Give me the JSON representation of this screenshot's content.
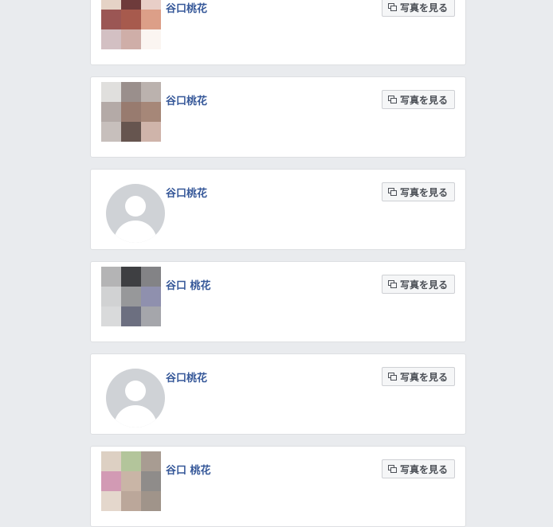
{
  "results": [
    {
      "name": "谷口桃花",
      "button_label": "写真を見る",
      "avatar_type": "photo",
      "avatar_colors": [
        "#e5d3c6",
        "#6e3b3b",
        "#e8cec7",
        "#9b5654",
        "#a75a4d",
        "#dc9f88",
        "#d3c0c3",
        "#cfaea8",
        "#fbf5f1"
      ]
    },
    {
      "name": "谷口桃花",
      "button_label": "写真を見る",
      "avatar_type": "photo",
      "avatar_colors": [
        "#e0dfdd",
        "#9a8f8c",
        "#bbb2ae",
        "#b4aaa7",
        "#987b6f",
        "#a68778",
        "#c7bfbc",
        "#66554f",
        "#cfb4aa"
      ]
    },
    {
      "name": "谷口桃花",
      "button_label": "写真を見る",
      "avatar_type": "default"
    },
    {
      "name": "谷口 桃花",
      "button_label": "写真を見る",
      "avatar_type": "photo",
      "avatar_colors": [
        "#b4b4b5",
        "#3e3f42",
        "#838386",
        "#d1d2d3",
        "#97989a",
        "#8f90ae",
        "#d9dadb",
        "#6c6f80",
        "#a5a6ab"
      ]
    },
    {
      "name": "谷口桃花",
      "button_label": "写真を見る",
      "avatar_type": "default"
    },
    {
      "name": "谷口 桃花",
      "button_label": "写真を見る",
      "avatar_type": "photo",
      "avatar_colors": [
        "#ddd0c3",
        "#b3c59b",
        "#a89c92",
        "#d29ab4",
        "#c9b5a6",
        "#8f8c8a",
        "#e4d7cc",
        "#bba79a",
        "#a0948a"
      ]
    }
  ]
}
